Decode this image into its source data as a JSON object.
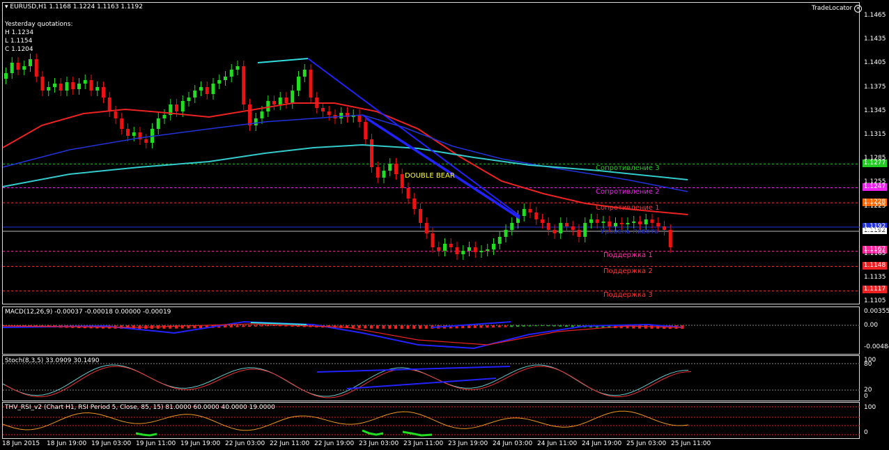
{
  "header": {
    "symbol_label": "EURUSD,H1  1.1168 1.1224 1.1163 1.1192",
    "yesterday_title": "Yesterday quotations:",
    "high": "H 1.1234",
    "low": "L 1.1154",
    "close": "C 1.1204",
    "brand": "TradeLocator"
  },
  "annotations": {
    "pattern": "DOUBLE BEAR"
  },
  "levels": [
    {
      "name": "Сопротивление 3",
      "price": 1.1277,
      "tag": "1.1277",
      "color": "#22cc22",
      "tag_bg": "#22cc22"
    },
    {
      "name": "Сопротивление 2",
      "price": 1.1247,
      "tag": "1.1247",
      "color": "#ee22ee",
      "tag_bg": "#ee22ee"
    },
    {
      "name": "Сопротивление 1",
      "price": 1.1228,
      "tag": "1.1228",
      "color": "#ff3333",
      "tag_bg": "#ff6600"
    },
    {
      "name": "Поддержка 1",
      "price": 1.1167,
      "tag": "1.1167",
      "color": "#ff33aa",
      "tag_bg": "#ff2299"
    },
    {
      "name": "Поддержка 2",
      "price": 1.1148,
      "tag": "1.1148",
      "color": "#ff3333",
      "tag_bg": "#ee2222"
    },
    {
      "name": "Поддержка 3",
      "price": 1.1117,
      "tag": "1.1117",
      "color": "#ff3333",
      "tag_bg": "#ee2222"
    }
  ],
  "pivot_label": "Уровень пивота",
  "current_price_tag": "1.1192",
  "pivot_tag": "1.1192",
  "price_axis": [
    "1.1465",
    "1.1435",
    "1.1405",
    "1.1375",
    "1.1345",
    "1.1315",
    "1.1285",
    "1.1255",
    "1.1225",
    "1.1195",
    "1.1165",
    "1.1135",
    "1.1105"
  ],
  "macd": {
    "label": "MACD(12,26,9) -0.00037 -0.00018 0.00000 -0.00019",
    "axis": [
      "0.00355",
      "0.00",
      "-0.00484"
    ]
  },
  "stoch": {
    "label": "Stoch(8,3,5) 33.0909 30.1490",
    "axis": [
      "100",
      "80",
      "20",
      "0"
    ]
  },
  "rsi": {
    "label": "THV_RSI_v2   (Chart H1,  RSI Period 5,  Close,  85,  15)  81.0000 60.0000 40.0000 19.0000",
    "axis": [
      "100",
      "0"
    ]
  },
  "time_axis": [
    "18 Jun 2015",
    "18 Jun 19:00",
    "19 Jun 03:00",
    "19 Jun 11:00",
    "19 Jun 19:00",
    "22 Jun 03:00",
    "22 Jun 11:00",
    "22 Jun 19:00",
    "23 Jun 03:00",
    "23 Jun 11:00",
    "23 Jun 19:00",
    "24 Jun 03:00",
    "24 Jun 11:00",
    "24 Jun 19:00",
    "25 Jun 03:00",
    "25 Jun 11:00"
  ],
  "colors": {
    "bull": "#22dd22",
    "bear": "#ee1111",
    "ma_fast": "#ee2222",
    "ma_mid": "#2233dd",
    "ma_slow": "#33cccc",
    "trendline": "#2222ff"
  }
}
